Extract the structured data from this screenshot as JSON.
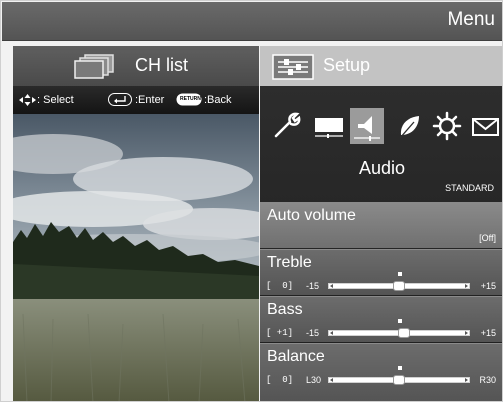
{
  "header": {
    "title": "Menu"
  },
  "tabs": {
    "left": {
      "label": "CH list",
      "icon": "ch-list-icon"
    },
    "right": {
      "label": "Setup",
      "icon": "setup-sliders-icon"
    }
  },
  "hints": {
    "select": ": Select",
    "enter": ":Enter",
    "back": ":Back",
    "return_key": "RETURN"
  },
  "category_icons": [
    "wrench-icon",
    "picture-icon",
    "audio-speaker-icon",
    "eco-leaf-icon",
    "gear-icon",
    "mail-icon"
  ],
  "category": {
    "title": "Audio",
    "preset": "STANDARD"
  },
  "items": [
    {
      "label": "Auto volume",
      "value": "[Off]"
    },
    {
      "label": "Treble",
      "bracket": "[  0]",
      "min": "-15",
      "max": "+15",
      "level": 0.5
    },
    {
      "label": "Bass",
      "bracket": "[ +1]",
      "min": "-15",
      "max": "+15",
      "level": 0.54
    },
    {
      "label": "Balance",
      "bracket": "[  0]",
      "min": "L30",
      "max": "R30",
      "level": 0.5
    }
  ]
}
